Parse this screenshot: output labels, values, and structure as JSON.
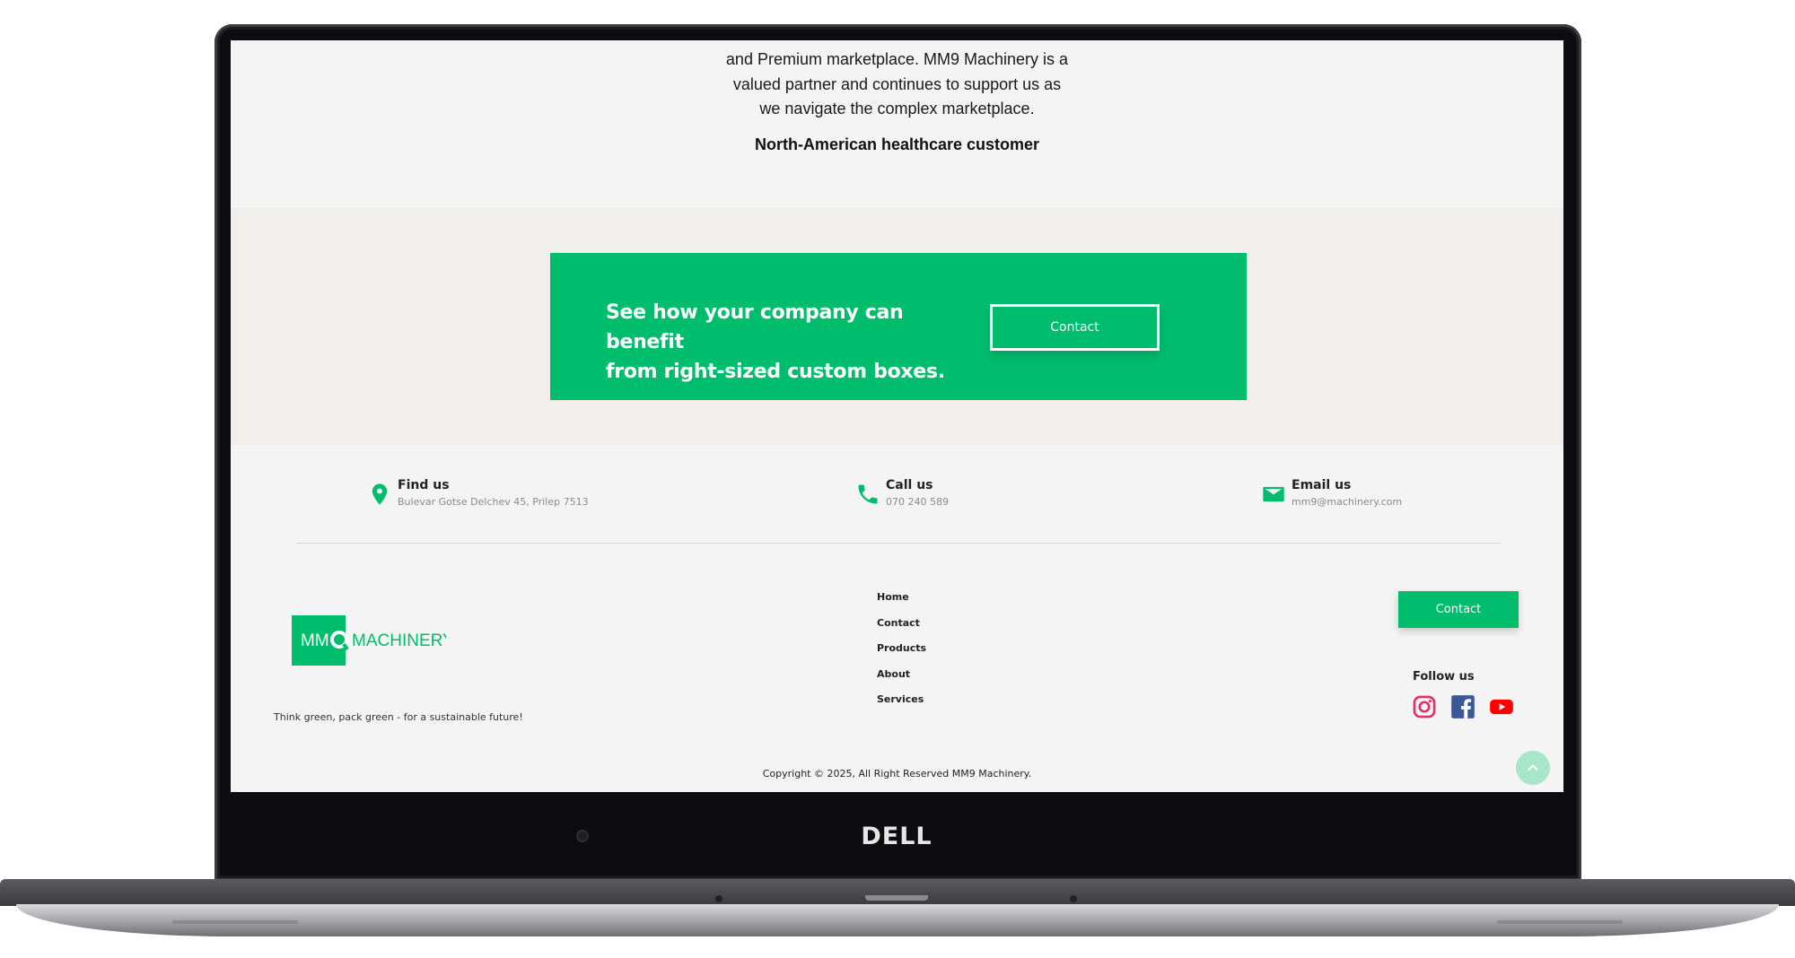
{
  "device": {
    "brand": "DELL"
  },
  "testimonial": {
    "lines": [
      "and Premium marketplace. MM9 Machinery is a",
      "valued partner and continues to support us as",
      "we navigate the complex marketplace."
    ],
    "author": "North-American healthcare customer"
  },
  "cta": {
    "heading_lines": [
      "See how your company can benefit",
      "from right-sized custom boxes."
    ],
    "button_label": "Contact"
  },
  "contact_info": {
    "find": {
      "title": "Find us",
      "value": "Bulevar Gotse Delchev 45, Prilep 7513",
      "icon": "map-pin-icon"
    },
    "call": {
      "title": "Call us",
      "value": "070 240 589",
      "icon": "phone-icon"
    },
    "email": {
      "title": "Email us",
      "value": "mm9@machinery.com",
      "icon": "envelope-icon"
    }
  },
  "footer": {
    "logo": {
      "mm": "MM",
      "machinery": "MACHINERY"
    },
    "tagline": "Think green, pack green - for a sustainable future!",
    "nav": [
      "Home",
      "Contact",
      "Products",
      "About",
      "Services"
    ],
    "contact_button": "Contact",
    "follow_label": "Follow us",
    "social": [
      "instagram-icon",
      "facebook-icon",
      "youtube-icon"
    ],
    "copyright": "Copyright © 2025, All Right Reserved MM9 Machinery."
  },
  "colors": {
    "accent_green": "#00bd6d",
    "instagram": "#e1306c",
    "facebook": "#3b5998",
    "youtube": "#ff0000",
    "scroll_top": "#a8e6c9"
  }
}
